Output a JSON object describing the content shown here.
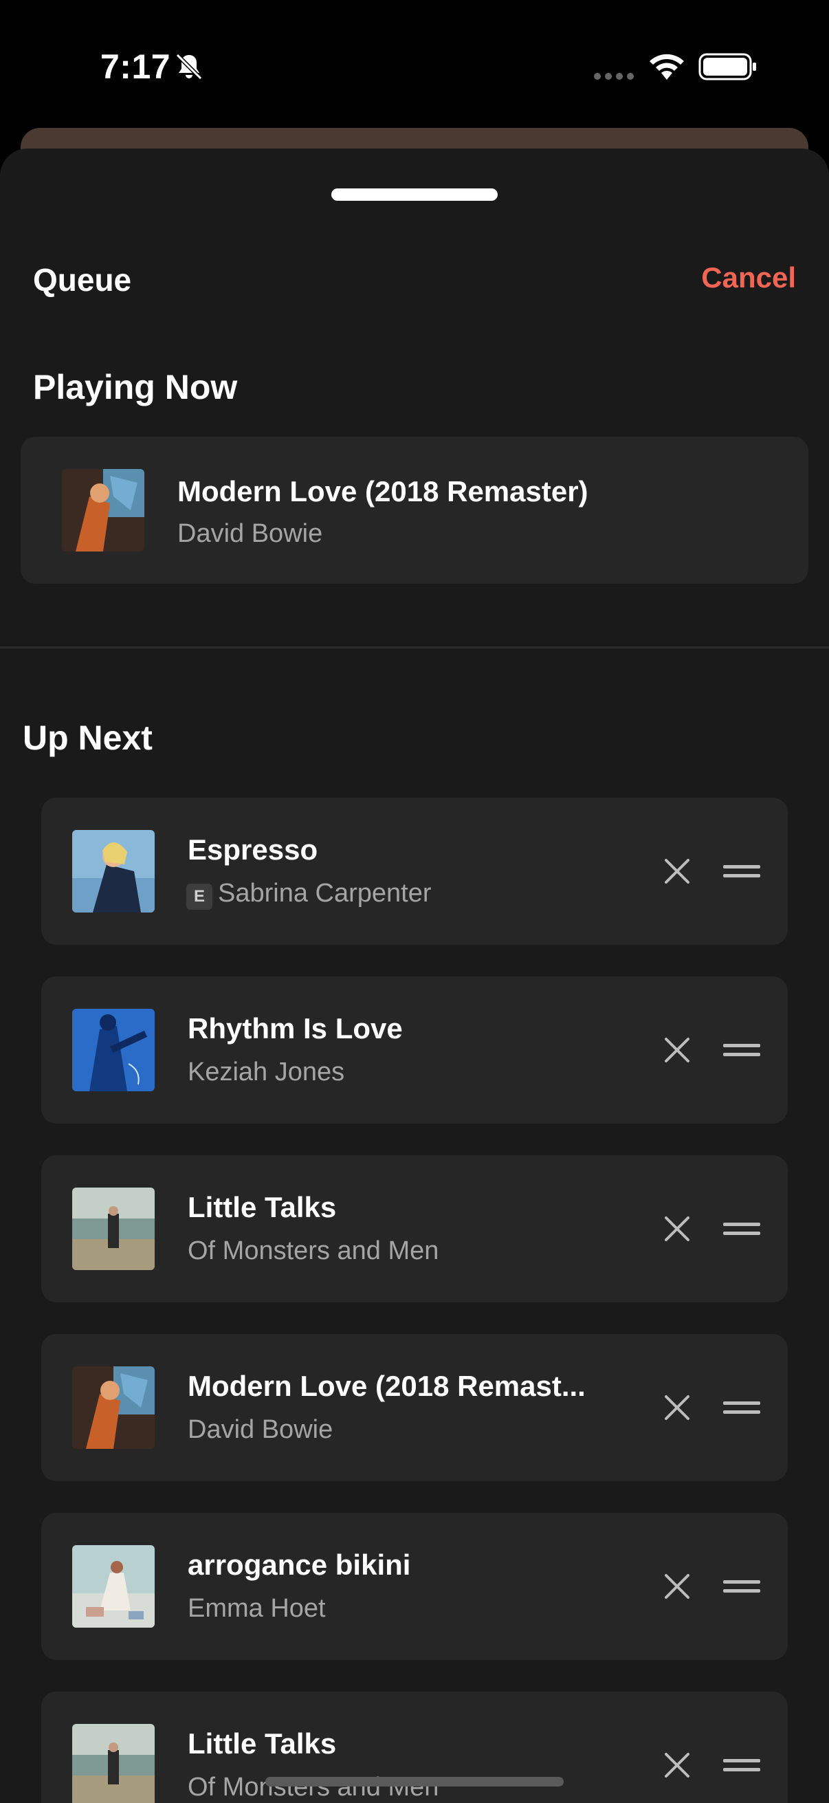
{
  "status_bar": {
    "time": "7:17"
  },
  "sheet": {
    "title": "Queue",
    "cancel_label": "Cancel"
  },
  "playing_now": {
    "heading": "Playing Now",
    "track": {
      "title": "Modern Love (2018 Remaster)",
      "artist": "David Bowie",
      "art": "lets-dance-cover"
    }
  },
  "up_next": {
    "heading": "Up Next",
    "items": [
      {
        "title": "Espresso",
        "artist": "Sabrina Carpenter",
        "explicit_label": "E",
        "art": "espresso-cover"
      },
      {
        "title": "Rhythm Is Love",
        "artist": "Keziah Jones",
        "art": "blue-guitar-cover"
      },
      {
        "title": "Little Talks",
        "artist": "Of Monsters and Men",
        "art": "beach-cover"
      },
      {
        "title": "Modern Love (2018 Remast...",
        "artist": "David Bowie",
        "art": "lets-dance-cover"
      },
      {
        "title": "arrogance bikini",
        "artist": "Emma Hoet",
        "art": "bikini-cover"
      },
      {
        "title": "Little Talks",
        "artist": "Of Monsters and Men",
        "art": "beach-cover"
      }
    ]
  },
  "colors": {
    "accent": "#f06553",
    "sheet_background": "#1a1a1a",
    "card_background": "#262626",
    "secondary_text": "#a5a5a5"
  }
}
